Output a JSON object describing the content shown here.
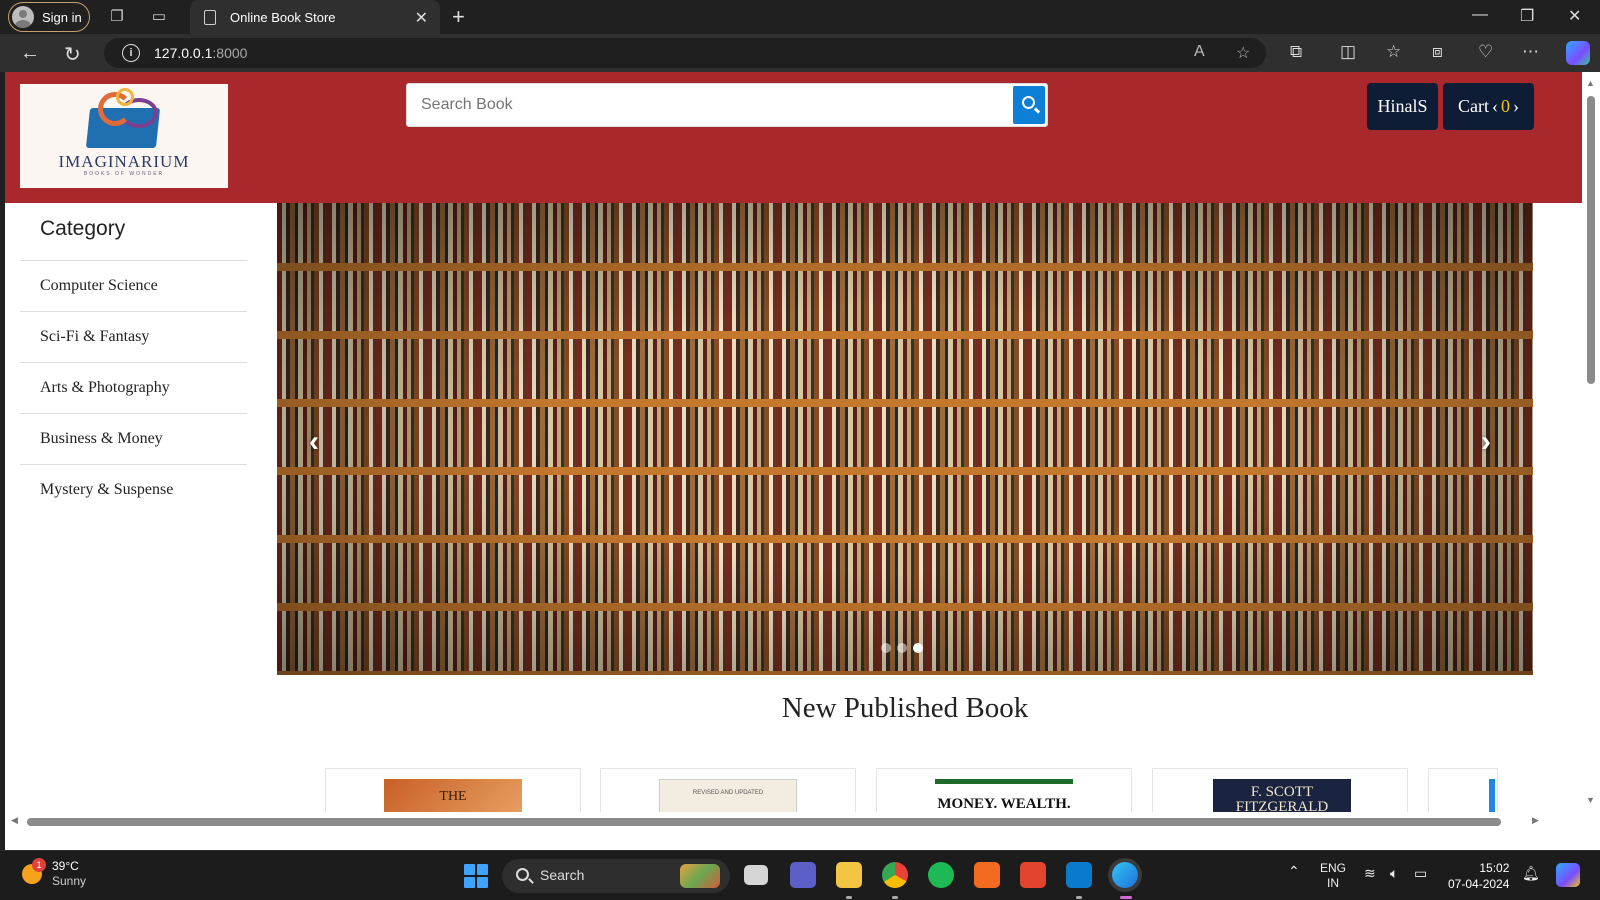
{
  "browser": {
    "signin_label": "Sign in",
    "tab_title": "Online Book Store",
    "url_host": "127.0.0.1",
    "url_port": ":8000"
  },
  "header": {
    "logo": {
      "name": "IMAGINARIUM",
      "tagline": "BOOKS OF WONDER"
    },
    "search": {
      "placeholder": "Search Book"
    },
    "user_label": "HinalS",
    "cart": {
      "label": "Cart",
      "count": "0"
    },
    "colors": {
      "header_bg": "#a8282c",
      "button_bg": "#0e1d35",
      "search_btn": "#0d7fd6",
      "cart_count": "#f0c419"
    }
  },
  "sidebar": {
    "title": "Category",
    "items": [
      {
        "label": "Computer Science"
      },
      {
        "label": "Sci-Fi & Fantasy"
      },
      {
        "label": "Arts & Photography"
      },
      {
        "label": "Business & Money"
      },
      {
        "label": "Mystery & Suspense"
      }
    ]
  },
  "carousel": {
    "image": "bookshelf-image",
    "prev_icon": "chevron-left-icon",
    "next_icon": "chevron-right-icon",
    "slide_count": 3,
    "active_slide": 3
  },
  "main": {
    "section_title": "New Published Book",
    "books": [
      {
        "cover_text": "THE"
      },
      {
        "cover_text": "REVISED AND UPDATED"
      },
      {
        "cover_text": "MONEY. WEALTH."
      },
      {
        "cover_text": "F. SCOTT FITZGERALD"
      }
    ]
  },
  "taskbar": {
    "weather": {
      "temp": "39°C",
      "condition": "Sunny",
      "badge": "1"
    },
    "search_label": "Search",
    "language": {
      "line1": "ENG",
      "line2": "IN"
    },
    "time": "15:02",
    "date": "07-04-2024"
  }
}
